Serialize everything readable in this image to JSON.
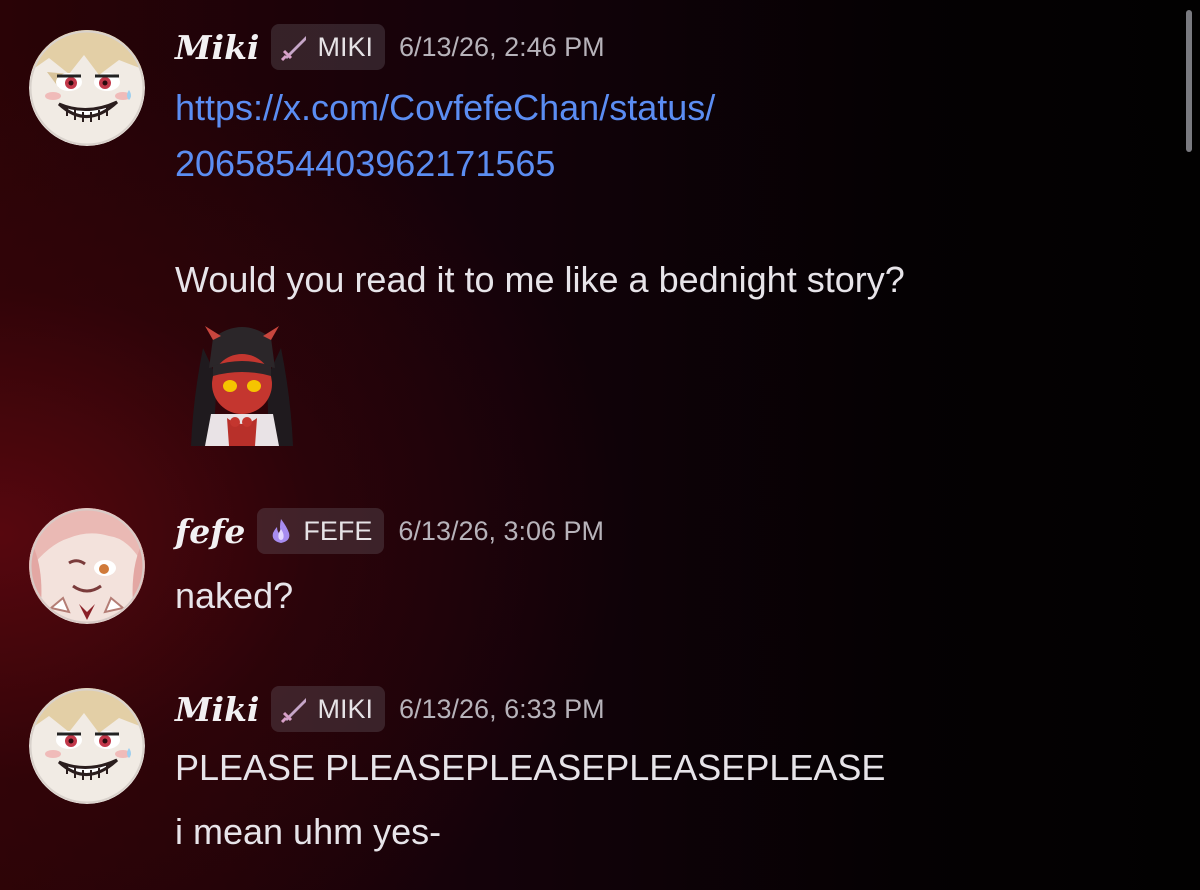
{
  "messages": [
    {
      "username": "Miki",
      "tag_label": "MIKI",
      "tag_icon": "sword-icon",
      "timestamp": "6/13/26, 2:46 PM",
      "link_line_1": "https://x.com/CovfefeChan/status/",
      "link_line_2": "2065854403962171565",
      "text": "Would you read it to me like a bednight story?",
      "sticker": "devil-girl-sticker"
    },
    {
      "username": "fefe",
      "tag_label": "FEFE",
      "tag_icon": "purple-flame-icon",
      "timestamp": "6/13/26, 3:06 PM",
      "text": "naked?"
    },
    {
      "username": "Miki",
      "tag_label": "MIKI",
      "tag_icon": "sword-icon",
      "timestamp": "6/13/26, 6:33 PM",
      "text_line_1": "PLEASE PLEASEPLEASEPLEASEPLEASE",
      "text_line_2": "i mean uhm yes-"
    }
  ],
  "colors": {
    "link": "#5b8df2",
    "text": "#e7e4e9",
    "timestamp": "#b7b3ba",
    "tag_bg": "#5a5159"
  }
}
